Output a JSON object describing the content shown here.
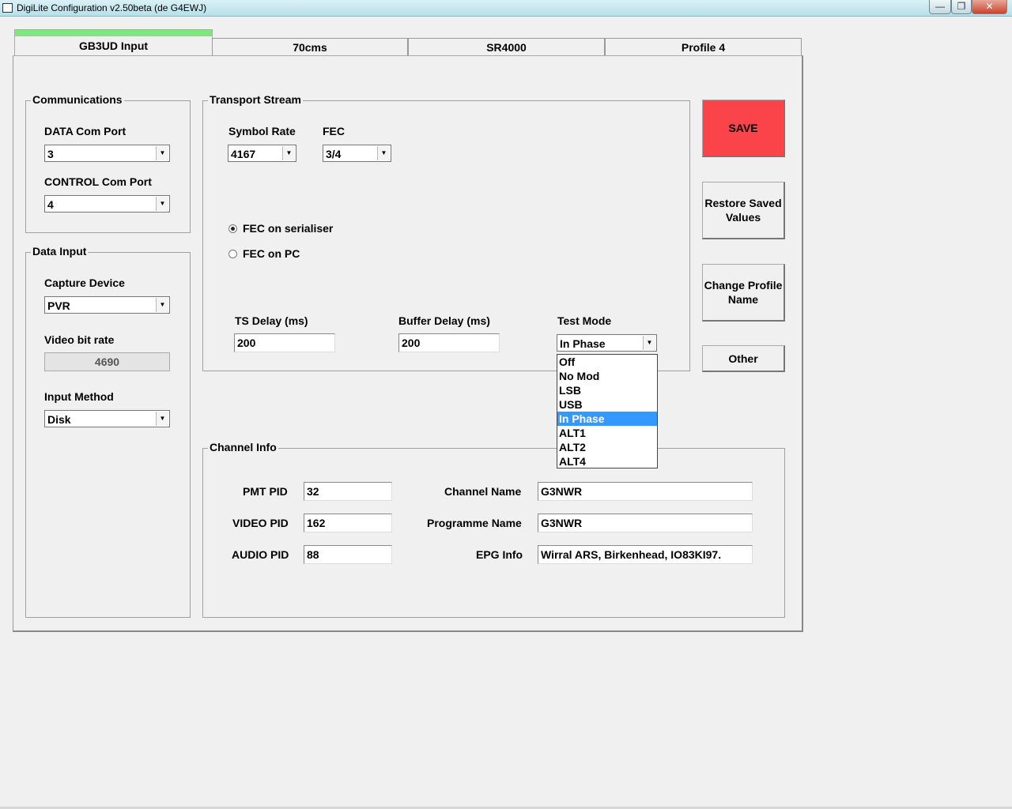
{
  "window": {
    "title": "DigiLite Configuration v2.50beta (de G4EWJ)",
    "min": "—",
    "restore": "❐",
    "close": "✕"
  },
  "tabs": [
    "GB3UD Input",
    "70cms",
    "SR4000",
    "Profile 4"
  ],
  "communications": {
    "legend": "Communications",
    "data_label": "DATA Com Port",
    "data_value": "3",
    "control_label": "CONTROL Com Port",
    "control_value": "4"
  },
  "data_input": {
    "legend": "Data Input",
    "capture_label": "Capture Device",
    "capture_value": "PVR",
    "bitrate_label": "Video bit rate",
    "bitrate_value": "4690",
    "method_label": "Input Method",
    "method_value": "Disk"
  },
  "transport": {
    "legend": "Transport Stream",
    "symbol_label": "Symbol Rate",
    "symbol_value": "4167",
    "fec_label": "FEC",
    "fec_value": "3/4",
    "radio_serialiser": "FEC on serialiser",
    "radio_pc": "FEC on PC",
    "ts_delay_label": "TS Delay (ms)",
    "ts_delay_value": "200",
    "buffer_delay_label": "Buffer Delay (ms)",
    "buffer_delay_value": "200",
    "test_mode_label": "Test Mode",
    "test_mode_value": "In Phase",
    "test_mode_options": [
      "Off",
      "No Mod",
      "LSB",
      "USB",
      "In Phase",
      "ALT1",
      "ALT2",
      "ALT4"
    ]
  },
  "channel": {
    "legend": "Channel Info",
    "pmt_label": "PMT PID",
    "pmt_value": "32",
    "video_label": "VIDEO PID",
    "video_value": "162",
    "audio_label": "AUDIO PID",
    "audio_value": "88",
    "name_label": "Channel Name",
    "name_value": "G3NWR",
    "programme_label": "Programme Name",
    "programme_value": "G3NWR",
    "epg_label": "EPG Info",
    "epg_value": "Wirral ARS, Birkenhead, IO83KI97."
  },
  "buttons": {
    "save": "SAVE",
    "restore": "Restore Saved Values",
    "change": "Change Profile Name",
    "other": "Other"
  },
  "colors": {
    "save_bg": "#fb434a",
    "selected_option": "#3399ff",
    "active_tab_indicator": "#7ee87e"
  }
}
